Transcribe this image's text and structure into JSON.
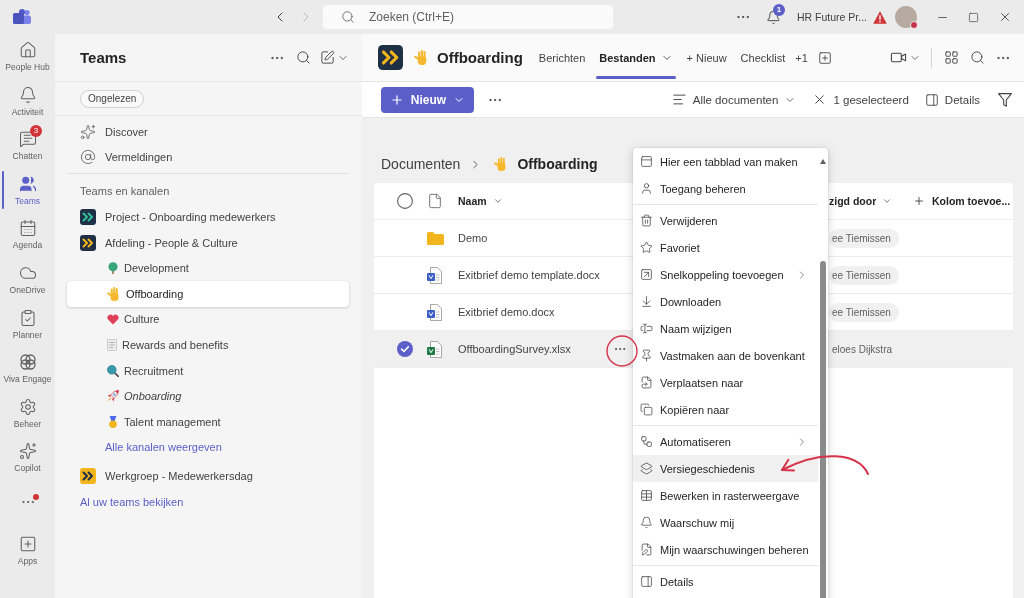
{
  "title_bar": {
    "back_disabled": false,
    "forward_disabled": true,
    "search": {
      "placeholder": "Zoeken (Ctrl+E)"
    },
    "notification_count": "1",
    "organization": "HR Future Pr...",
    "warning": true,
    "busy": true
  },
  "rail": {
    "items": [
      {
        "label": "People Hub",
        "selected": false
      },
      {
        "label": "Activiteit",
        "selected": false
      },
      {
        "label": "Chatten",
        "selected": false,
        "badge": "3"
      },
      {
        "label": "Teams",
        "selected": true
      },
      {
        "label": "Agenda",
        "selected": false
      },
      {
        "label": "OneDrive",
        "selected": false
      },
      {
        "label": "Planner",
        "selected": false
      },
      {
        "label": "Viva Engage",
        "selected": false
      },
      {
        "label": "Beheer",
        "selected": false
      },
      {
        "label": "Copilot",
        "selected": false
      }
    ],
    "more": {
      "unread": true
    },
    "apps": {
      "label": "Apps"
    }
  },
  "sidebar": {
    "title": "Teams",
    "filter": {
      "label": "Ongelezen",
      "selected": false
    },
    "links": [
      "Discover",
      "Vermeldingen"
    ],
    "section": "Teams en kanalen",
    "teams": [
      {
        "name": "Project - Onboarding medewerkers",
        "logo": {
          "color": "#1e2f46"
        },
        "chevrons": {
          "color": "#2fbf9a"
        }
      },
      {
        "name": "Afdeling - People & Culture",
        "logo": {
          "color": "#1e2f46"
        },
        "chevrons": {
          "color": "#f2b51d"
        },
        "channels": [
          {
            "name": "Development",
            "selected": false,
            "hidden": false
          },
          {
            "name": "Offboarding",
            "selected": true,
            "hidden": false
          },
          {
            "name": "Culture",
            "selected": false,
            "hidden": false
          },
          {
            "name": "Rewards and benefits",
            "selected": false,
            "hidden": false
          },
          {
            "name": "Recruitment",
            "selected": false,
            "hidden": false
          },
          {
            "name": "Onboarding",
            "selected": false,
            "hidden": true
          },
          {
            "name": "Talent management",
            "selected": false,
            "hidden": false
          }
        ],
        "more_link": "Alle kanalen weergeven"
      },
      {
        "name": "Werkgroep - Medewerkersdag",
        "logo": {
          "color": "#f2b51d"
        },
        "chevrons": {
          "color": "#1e2f46"
        }
      }
    ],
    "all_teams_link": "Al uw teams bekijken"
  },
  "channel_header": {
    "title": "Offboarding",
    "tabs": [
      {
        "label": "Berichten",
        "selected": false,
        "menu": false
      },
      {
        "label": "Bestanden",
        "selected": true,
        "menu": true
      },
      {
        "label": "+ Nieuw",
        "selected": false,
        "menu": false
      },
      {
        "label": "Checklist",
        "selected": false,
        "menu": false
      }
    ],
    "overflow": "+1"
  },
  "toolbar": {
    "new_button": "Nieuw",
    "view": "Alle documenten",
    "selection": "1 geselecteerd",
    "details": "Details"
  },
  "breadcrumb": [
    "Documenten",
    "Offboarding"
  ],
  "table": {
    "select_all": false,
    "columns": [
      "Naam",
      "zigd door",
      "Kolom toevoe..."
    ],
    "rows": [
      {
        "name": "Demo",
        "kind": "folder",
        "modified_by": "ee Tiemissen",
        "selected": false
      },
      {
        "name": "Exitbrief demo template.docx",
        "kind": "word",
        "modified_by": "ee Tiemissen",
        "selected": false
      },
      {
        "name": "Exitbrief demo.docx",
        "kind": "word",
        "modified_by": "ee Tiemissen",
        "selected": false
      },
      {
        "name": "OffboardingSurvey.xlsx",
        "kind": "excel",
        "modified_by": "eloes Dijkstra",
        "selected": true
      }
    ]
  },
  "context_menu": {
    "groups": [
      [
        {
          "label": "Hier een tabblad van maken",
          "submenu": false,
          "highlighted": false
        },
        {
          "label": "Toegang beheren",
          "submenu": false,
          "highlighted": false
        }
      ],
      [
        {
          "label": "Verwijderen",
          "submenu": false,
          "highlighted": false
        },
        {
          "label": "Favoriet",
          "submenu": false,
          "highlighted": false
        },
        {
          "label": "Snelkoppeling toevoegen",
          "submenu": true,
          "highlighted": false
        },
        {
          "label": "Downloaden",
          "submenu": false,
          "highlighted": false
        },
        {
          "label": "Naam wijzigen",
          "submenu": false,
          "highlighted": false
        },
        {
          "label": "Vastmaken aan de bovenkant",
          "submenu": false,
          "highlighted": false
        },
        {
          "label": "Verplaatsen naar",
          "submenu": false,
          "highlighted": false
        },
        {
          "label": "Kopiëren naar",
          "submenu": false,
          "highlighted": false
        }
      ],
      [
        {
          "label": "Automatiseren",
          "submenu": true,
          "highlighted": false
        },
        {
          "label": "Versiegeschiedenis",
          "submenu": false,
          "highlighted": true
        },
        {
          "label": "Bewerken in rasterweergave",
          "submenu": false,
          "highlighted": false
        },
        {
          "label": "Waarschuw mij",
          "submenu": false,
          "highlighted": false
        },
        {
          "label": "Mijn waarschuwingen beheren",
          "submenu": false,
          "highlighted": false
        }
      ],
      [
        {
          "label": "Details",
          "submenu": false,
          "highlighted": false
        }
      ]
    ]
  },
  "annotations": [
    {
      "kind": "circle"
    },
    {
      "kind": "arrow"
    }
  ]
}
